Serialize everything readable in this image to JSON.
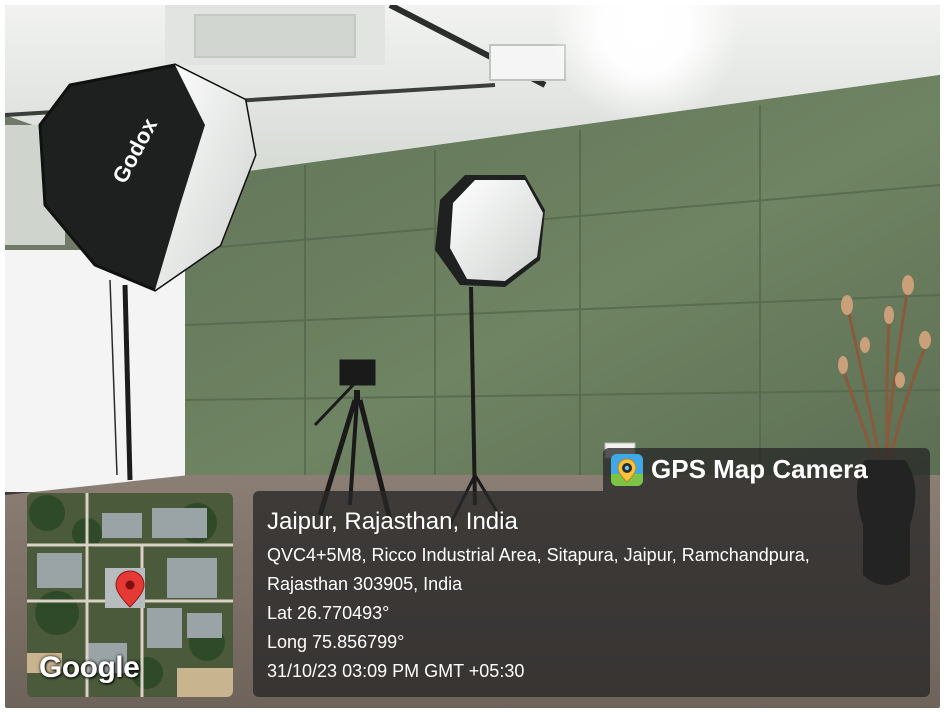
{
  "overlay": {
    "app_name": "GPS Map Camera",
    "app_icon": "map-pin-camera-icon",
    "place": "Jaipur, Rajasthan, India",
    "address_line1": "QVC4+5M8, Ricco Industrial Area, Sitapura, Jaipur, Ramchandpura,",
    "address_line2": "Rajasthan 303905, India",
    "latitude": "Lat 26.770493°",
    "longitude": "Long 75.856799°",
    "datetime": "31/10/23 03:09 PM GMT +05:30"
  },
  "map": {
    "attribution": "Google",
    "marker_color": "#e53935"
  },
  "photo": {
    "softbox_brand": "Godox",
    "wall_color": "#667b5a",
    "ceiling_color": "#e9ebe8"
  }
}
